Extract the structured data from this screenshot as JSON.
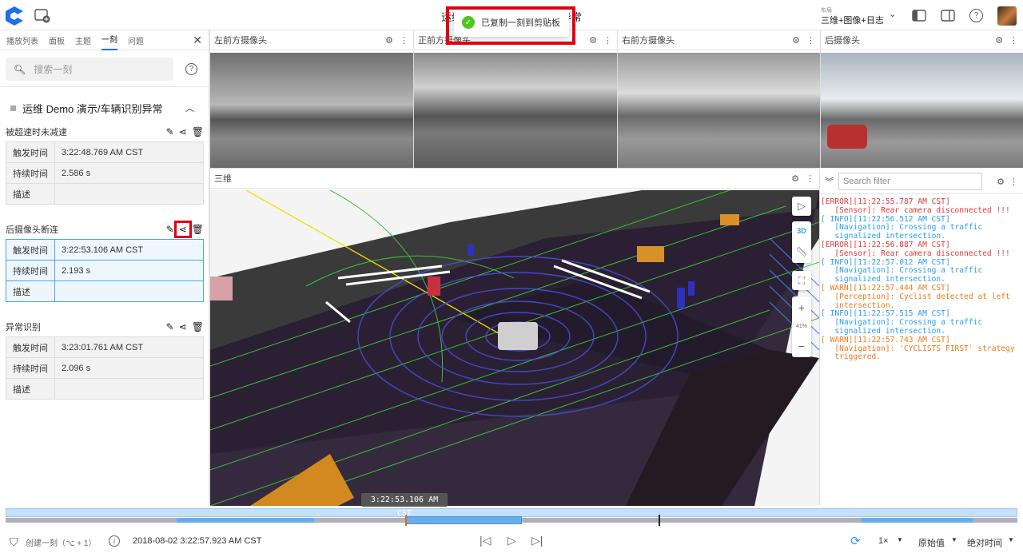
{
  "header": {
    "title": "运维 Demo 演示/车辆识别异常",
    "layout_label": "布局",
    "layout_value": "三维+图像+日志",
    "icons": [
      "app-logo",
      "add-window-icon",
      "chevron-down-icon",
      "left-sidebar-toggle-icon",
      "right-sidebar-toggle-icon",
      "help-icon",
      "user-avatar"
    ]
  },
  "toast": {
    "message": "已复制一刻到剪贴板",
    "icon": "check-circle-icon",
    "highlight_color": "#e0000f"
  },
  "sidebar": {
    "tabs": [
      {
        "label": "播放列表"
      },
      {
        "label": "面板"
      },
      {
        "label": "主题"
      },
      {
        "label": "一刻",
        "active": true
      },
      {
        "label": "问题"
      }
    ],
    "search_placeholder": "搜索一刻",
    "section_title": "运维 Demo 演示/车辆识别异常",
    "moments": [
      {
        "title": "被超速时未减速",
        "rows": [
          {
            "k": "触发时间",
            "v": "3:22:48.769 AM CST"
          },
          {
            "k": "持续时间",
            "v": "2.586 s"
          },
          {
            "k": "描述",
            "v": ""
          }
        ]
      },
      {
        "title": "后摄像头断连",
        "selected": true,
        "rows": [
          {
            "k": "触发时间",
            "v": "3:22:53.106 AM CST"
          },
          {
            "k": "持续时间",
            "v": "2.193 s"
          },
          {
            "k": "描述",
            "v": ""
          }
        ]
      },
      {
        "title": "异常识别",
        "rows": [
          {
            "k": "触发时间",
            "v": "3:23:01.761 AM CST"
          },
          {
            "k": "持续时间",
            "v": "2.096 s"
          },
          {
            "k": "描述",
            "v": ""
          }
        ]
      }
    ]
  },
  "cameras": [
    {
      "title": "左前方摄像头"
    },
    {
      "title": "正前方摄像头"
    },
    {
      "title": "右前方摄像头"
    },
    {
      "title": "后摄像头"
    }
  ],
  "scene3d": {
    "title": "三维",
    "toolbar": {
      "mode": "3D",
      "zoom": "41%"
    }
  },
  "logs": {
    "filter_placeholder": "Search filter",
    "colors": {
      "ERROR": "#e03a3a",
      "INFO": "#2a9df4",
      "WARN": "#f07a1a"
    },
    "entries": [
      {
        "level": "ERROR",
        "head": "[ERROR][11:22:55.787 AM CST]",
        "body": "   [Sensor]: Rear camera disconnected !!!"
      },
      {
        "level": "INFO",
        "head": "[ INFO][11:22:56.512 AM CST]",
        "body": "   [Navigation]: Crossing a traffic\n   signalized intersection."
      },
      {
        "level": "ERROR",
        "head": "[ERROR][11:22:56.887 AM CST]",
        "body": "   [Sensor]: Rear camera disconnected !!!"
      },
      {
        "level": "INFO",
        "head": "[ INFO][11:22:57.012 AM CST]",
        "body": "   [Navigation]: Crossing a traffic\n   signalized intersection."
      },
      {
        "level": "WARN",
        "head": "[ WARN][11:22:57.444 AM CST]",
        "body": "   [Perception]: Cyclist detected at left\n   intersection."
      },
      {
        "level": "INFO",
        "head": "[ INFO][11:22:57.515 AM CST]",
        "body": "   [Navigation]: Crossing a traffic\n   signalized intersection."
      },
      {
        "level": "WARN",
        "head": "[ WARN][11:22:57.743 AM CST]",
        "body": "   [Navigation]: 'CYCLISTS FIRST' strategy\n   triggered."
      }
    ]
  },
  "timeline": {
    "hover_time": "3:22:53.106 AM CST"
  },
  "bottom": {
    "create_moment": "创建一刻（⌥ + 1）",
    "current_time": "2018-08-02 3:22:57.923 AM CST",
    "speed": "1×",
    "value_mode": "原始值",
    "time_mode": "绝对时间"
  }
}
